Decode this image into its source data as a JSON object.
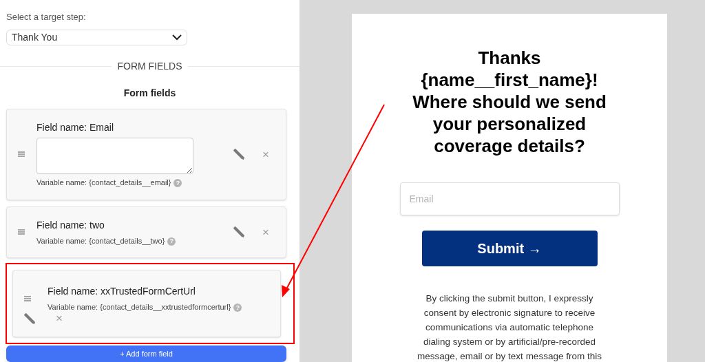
{
  "target_step": {
    "label": "Select a target step:",
    "value": "Thank You"
  },
  "section_title": "FORM FIELDS",
  "list_title": "Form fields",
  "fields": [
    {
      "kind": "textarea",
      "name": "Field name: Email",
      "variable": "Variable name: {contact_details__email}",
      "help": "?",
      "remove": "×",
      "highlighted": false
    },
    {
      "kind": "plain",
      "name": "Field name: two",
      "variable": "Variable name: {contact_details__two}",
      "help": "?",
      "remove": "×",
      "highlighted": false
    },
    {
      "kind": "wrapped",
      "name": "Field name: xxTrustedFormCertUrl",
      "variable": "Variable name: {contact_details__xxtrustedformcerturl}",
      "help": "?",
      "remove": "×",
      "highlighted": true
    }
  ],
  "add_button": "+ Add form field",
  "preview": {
    "heading_lines": [
      "Thanks",
      "{name__first_name}!",
      "Where should we send",
      "your personalized",
      "coverage details?"
    ],
    "email_placeholder": "Email",
    "submit": "Submit →",
    "consent_lines": [
      "By clicking the submit button, I expressly",
      "consent by electronic signature to receive",
      "communications via automatic telephone",
      "dialing system or by artificial/pre-recorded",
      "message, email or by text message from this"
    ]
  }
}
